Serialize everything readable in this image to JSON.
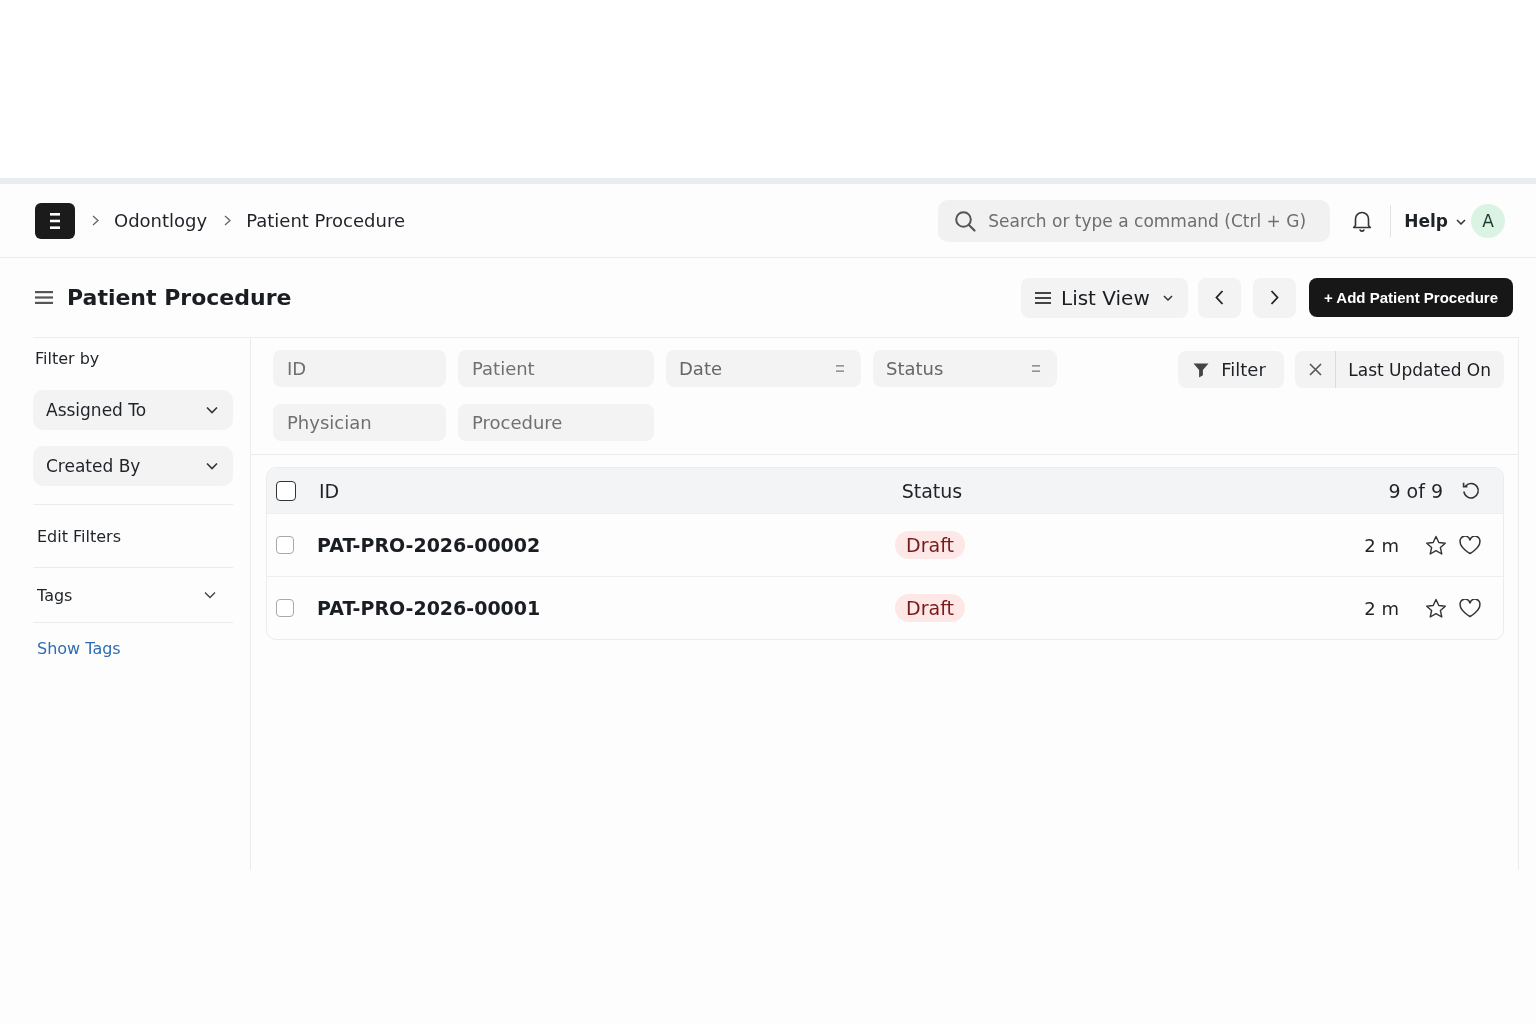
{
  "navbar": {
    "breadcrumbs": [
      "Odontlogy",
      "Patient Procedure"
    ],
    "search": {
      "placeholder": "Search or type a command (Ctrl + G)"
    },
    "help": "Help",
    "avatar": "A"
  },
  "page_head": {
    "title": "Patient Procedure",
    "view_switcher": "List View",
    "primary_button": "+ Add Patient Procedure"
  },
  "sidebar": {
    "heading": "Filter by",
    "group_by": [
      {
        "label": "Assigned To",
        "expanded": false
      },
      {
        "label": "Created By",
        "expanded": false
      }
    ],
    "edit_filters": "Edit Filters",
    "tags": {
      "label": "Tags",
      "expanded": false
    },
    "show_tags": "Show Tags"
  },
  "filters": {
    "fields": [
      {
        "placeholder": "ID",
        "kind": "text"
      },
      {
        "placeholder": "Patient",
        "kind": "text"
      },
      {
        "placeholder": "Date",
        "kind": "select"
      },
      {
        "placeholder": "Status",
        "kind": "select"
      },
      {
        "placeholder": "Physician",
        "kind": "text"
      },
      {
        "placeholder": "Procedure",
        "kind": "text"
      }
    ],
    "filter_button": "Filter",
    "sort": "Last Updated On"
  },
  "list": {
    "columns": [
      "ID",
      "Status"
    ],
    "count": "9 of 9",
    "select_all": {
      "checked": false
    },
    "rows": [
      {
        "id": "PAT-PRO-2026-00002",
        "status": "Draft",
        "modified": "2 m",
        "checked": false,
        "liked": false
      },
      {
        "id": "PAT-PRO-2026-00001",
        "status": "Draft",
        "modified": "2 m",
        "checked": false,
        "liked": false
      }
    ]
  }
}
